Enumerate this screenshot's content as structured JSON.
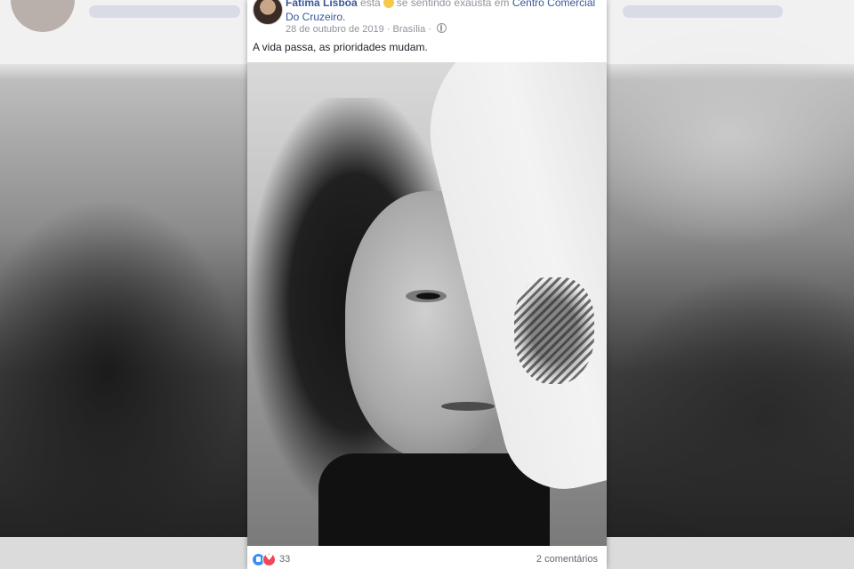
{
  "post": {
    "author": "Fatima Lisboa",
    "feeling_prefix": "está",
    "feeling_text": "se sentindo exausta em",
    "place": "Centro Comercial Do Cruzeiro.",
    "date": "28 de outubro de 2019",
    "separator": "·",
    "location": "Brasília",
    "caption": "A vida passa, as prioridades mudam."
  },
  "footer": {
    "reaction_count": "33",
    "comments": "2 comentários"
  },
  "colors": {
    "link": "#385898",
    "like": "#3a8ff0",
    "love": "#f0455a",
    "meta_text": "#90949c"
  }
}
